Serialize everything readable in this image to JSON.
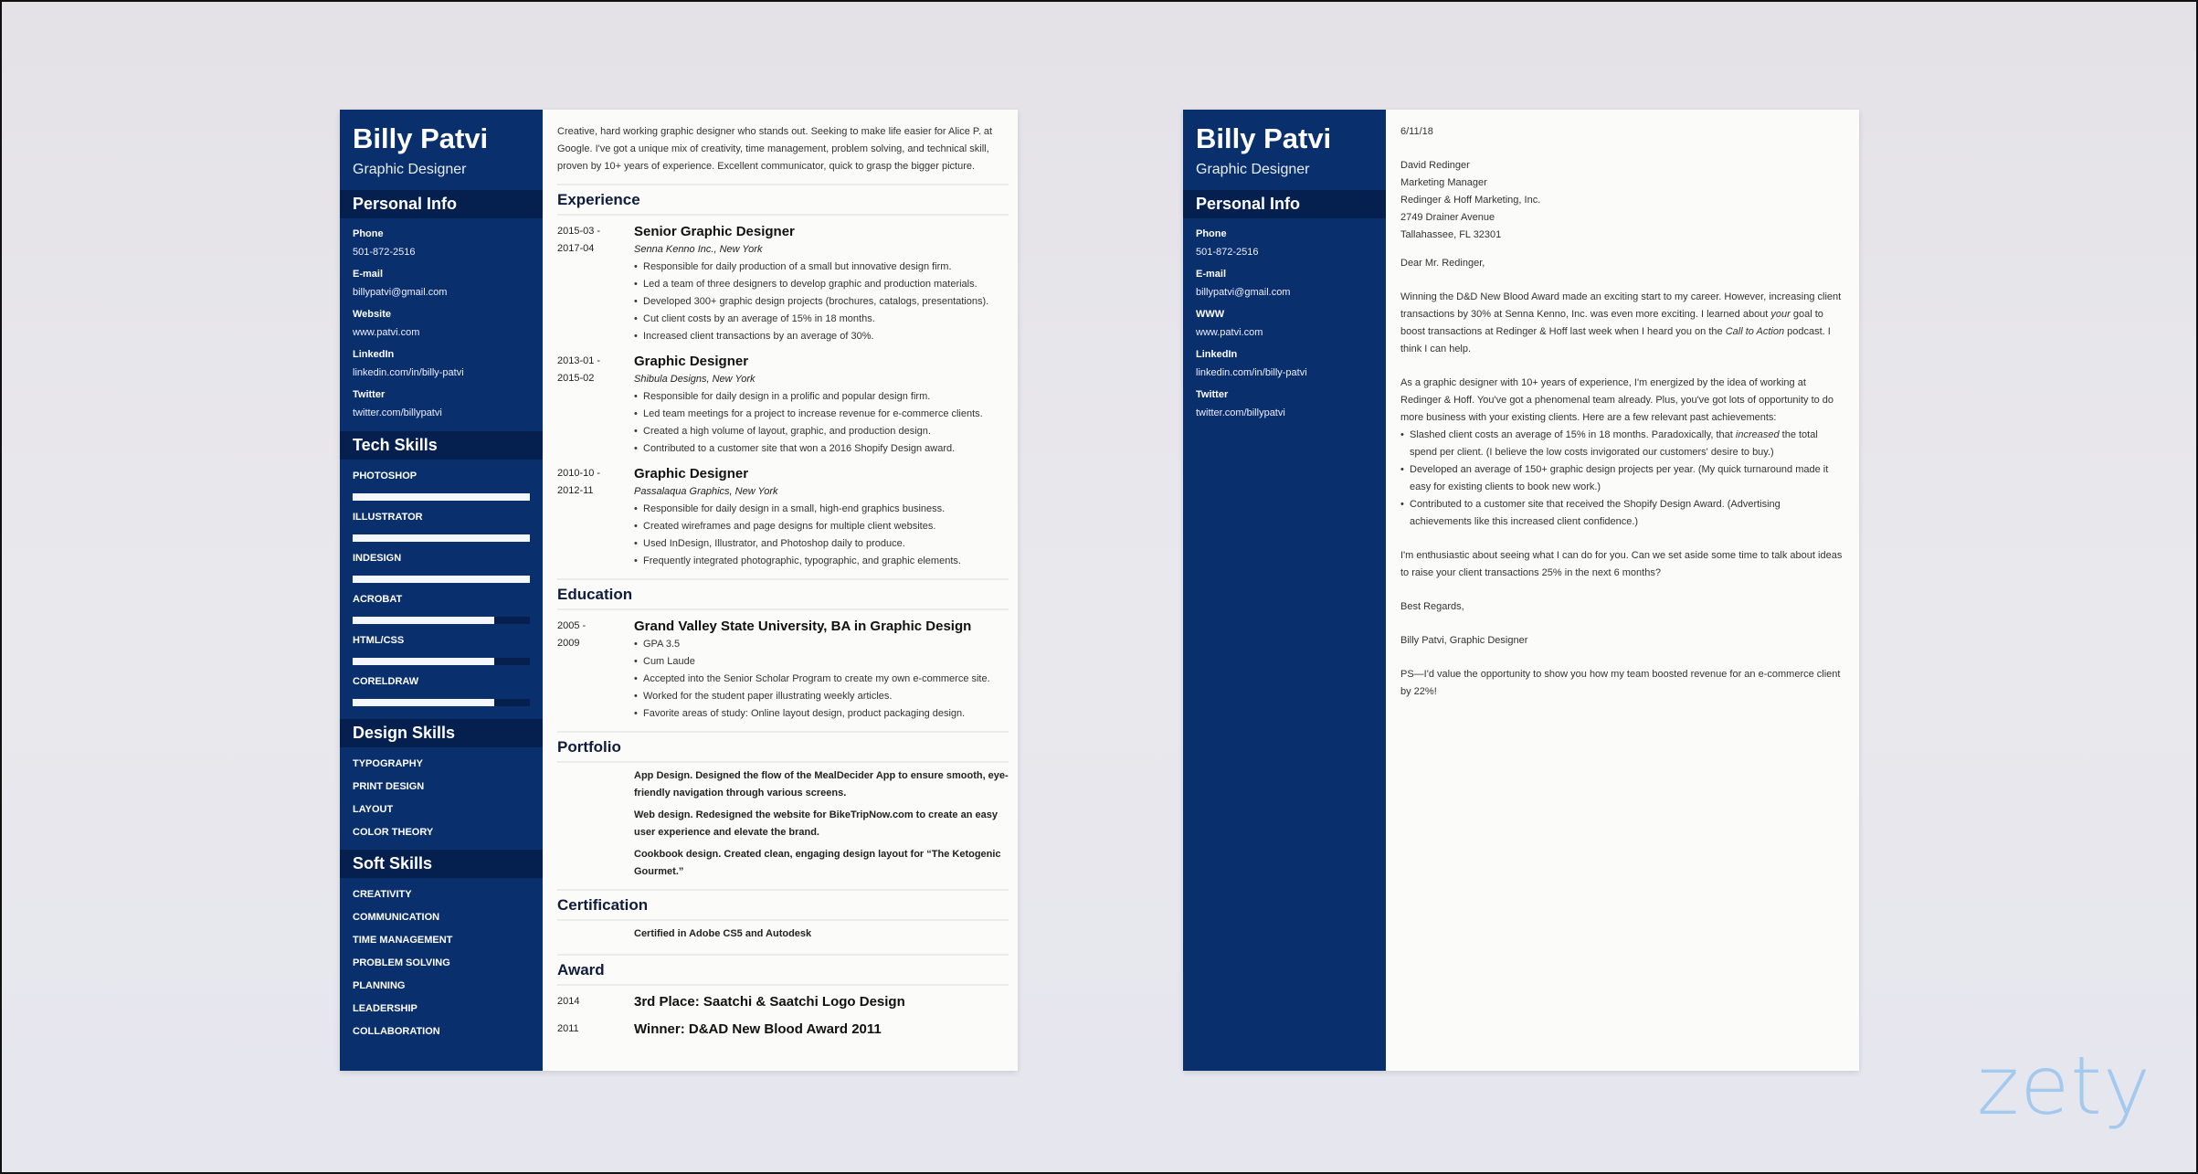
{
  "resume": {
    "name": "Billy Patvi",
    "job_title": "Graphic Designer",
    "personal_info": {
      "heading": "Personal Info",
      "fields": [
        {
          "label": "Phone",
          "value": "501-872-2516"
        },
        {
          "label": "E-mail",
          "value": "billypatvi@gmail.com"
        },
        {
          "label": "Website",
          "value": "www.patvi.com"
        },
        {
          "label": "LinkedIn",
          "value": "linkedin.com/in/billy-patvi"
        },
        {
          "label": "Twitter",
          "value": "twitter.com/billypatvi"
        }
      ]
    },
    "tech_skills": {
      "heading": "Tech Skills",
      "items": [
        {
          "name": "PHOTOSHOP",
          "level": 1.0
        },
        {
          "name": "ILLUSTRATOR",
          "level": 1.0
        },
        {
          "name": "INDESIGN",
          "level": 1.0
        },
        {
          "name": "ACROBAT",
          "level": 0.8
        },
        {
          "name": "HTML/CSS",
          "level": 0.8
        },
        {
          "name": "CORELDRAW",
          "level": 0.8
        }
      ]
    },
    "design_skills": {
      "heading": "Design Skills",
      "items": [
        "TYPOGRAPHY",
        "PRINT DESIGN",
        "LAYOUT",
        "COLOR THEORY"
      ]
    },
    "soft_skills": {
      "heading": "Soft Skills",
      "items": [
        "CREATIVITY",
        "COMMUNICATION",
        "TIME MANAGEMENT",
        "PROBLEM SOLVING",
        "PLANNING",
        "LEADERSHIP",
        "COLLABORATION"
      ]
    },
    "summary": "Creative, hard working graphic designer who stands out. Seeking to make life easier for Alice P. at Google. I've got a unique mix of creativity, time management, problem solving, and technical skill, proven by 10+ years of experience. Excellent communicator, quick to grasp the bigger picture.",
    "experience": {
      "heading": "Experience",
      "entries": [
        {
          "date_start": "2015-03 -",
          "date_end": "2017-04",
          "title": "Senior Graphic Designer",
          "company": "Senna Kenno Inc., New York",
          "bullets": [
            "Responsible for daily production of a small but innovative design firm.",
            "Led a team of three designers to develop graphic and production materials.",
            "Developed 300+ graphic design projects (brochures, catalogs, presentations).",
            "Cut client costs by an average of 15% in 18 months.",
            "Increased client transactions by an average of 30%."
          ]
        },
        {
          "date_start": "2013-01 -",
          "date_end": "2015-02",
          "title": "Graphic Designer",
          "company": "Shibula Designs, New York",
          "bullets": [
            "Responsible for daily design in a prolific and popular design firm.",
            "Led team meetings for a project to increase revenue for e-commerce clients.",
            "Created a high volume of layout, graphic, and production design.",
            "Contributed to a customer site that won a 2016 Shopify Design award."
          ]
        },
        {
          "date_start": "2010-10 -",
          "date_end": "2012-11",
          "title": "Graphic Designer",
          "company": "Passalaqua Graphics, New York",
          "bullets": [
            "Responsible for daily design in a small, high-end graphics business.",
            "Created wireframes and page designs for multiple client websites.",
            "Used InDesign, Illustrator, and Photoshop daily to produce.",
            "Frequently integrated photographic, typographic, and graphic elements."
          ]
        }
      ]
    },
    "education": {
      "heading": "Education",
      "entry": {
        "date_start": "2005 -",
        "date_end": "2009",
        "title": "Grand Valley State University, BA in Graphic Design",
        "bullets": [
          "GPA 3.5",
          "Cum Laude",
          "Accepted into the Senior Scholar Program to create my own e-commerce site.",
          "Worked for the student paper illustrating weekly articles.",
          "Favorite areas of study: Online layout design, product packaging design."
        ]
      }
    },
    "portfolio": {
      "heading": "Portfolio",
      "items": [
        "App Design. Designed the flow of the MealDecider App to ensure smooth, eye-friendly navigation through various screens.",
        "Web design. Redesigned the website for BikeTripNow.com to create an easy user experience and elevate the brand.",
        "Cookbook design. Created clean, engaging design layout for “The Ketogenic Gourmet.”"
      ]
    },
    "certification": {
      "heading": "Certification",
      "items": [
        "Certified in Adobe CS5 and Autodesk"
      ]
    },
    "award": {
      "heading": "Award",
      "items": [
        {
          "year": "2014",
          "title": "3rd Place: Saatchi & Saatchi Logo Design"
        },
        {
          "year": "2011",
          "title": "Winner: D&AD New Blood Award 2011"
        }
      ]
    }
  },
  "cover_letter": {
    "name": "Billy Patvi",
    "job_title": "Graphic Designer",
    "personal_info": {
      "heading": "Personal Info",
      "fields": [
        {
          "label": "Phone",
          "value": "501-872-2516"
        },
        {
          "label": "E-mail",
          "value": "billypatvi@gmail.com"
        },
        {
          "label": "WWW",
          "value": "www.patvi.com"
        },
        {
          "label": "LinkedIn",
          "value": "linkedin.com/in/billy-patvi"
        },
        {
          "label": "Twitter",
          "value": "twitter.com/billypatvi"
        }
      ]
    },
    "date": "6/11/18",
    "recipient": [
      "David Redinger",
      "Marketing Manager",
      "Redinger & Hoff Marketing, Inc.",
      "2749 Drainer Avenue",
      "Tallahassee, FL 32301"
    ],
    "salutation": "Dear Mr. Redinger,",
    "para1_a": "Winning the D&D New Blood Award made an exciting start to my career. However, increasing client transactions by 30% at Senna Kenno, Inc. was even more exciting. I learned about ",
    "para1_em1": "your",
    "para1_b": " goal to boost transactions at Redinger & Hoff last week when I heard you on the ",
    "para1_em2": "Call to Action",
    "para1_c": " podcast. I think I can help.",
    "para2": "As a graphic designer with 10+ years of experience, I'm energized by the idea of working at Redinger & Hoff. You've got a phenomenal team already. Plus, you've got lots of opportunity to do more business with your existing clients. Here are a few relevant past achievements:",
    "achievement1_a": "Slashed client costs an average of 15% in 18 months. Paradoxically, that ",
    "achievement1_em": "increased",
    "achievement1_b": " the total spend per client. (I believe the low costs invigorated our customers' desire to buy.)",
    "achievement2": "Developed an average of 150+ graphic design projects per year. (My quick turnaround made it easy for existing clients to book new work.)",
    "achievement3": "Contributed to a customer site that received the Shopify Design Award. (Advertising achievements like this increased client confidence.)",
    "para3": "I'm enthusiastic about seeing what I can do for you. Can we set aside some time to talk about ideas to raise your client transactions 25% in the next 6 months?",
    "closing": "Best Regards,",
    "signature": "Billy Patvi, Graphic Designer",
    "ps": "PS—I'd value the opportunity to show you how my team boosted revenue for an e-commerce client by 22%!"
  },
  "watermark": {
    "text": "zety",
    "color": "#9cc6ee"
  },
  "colors": {
    "sidebar": "#0a2f6d",
    "sidebar_header": "#05204f",
    "heading_text": "#0f1c3a"
  }
}
